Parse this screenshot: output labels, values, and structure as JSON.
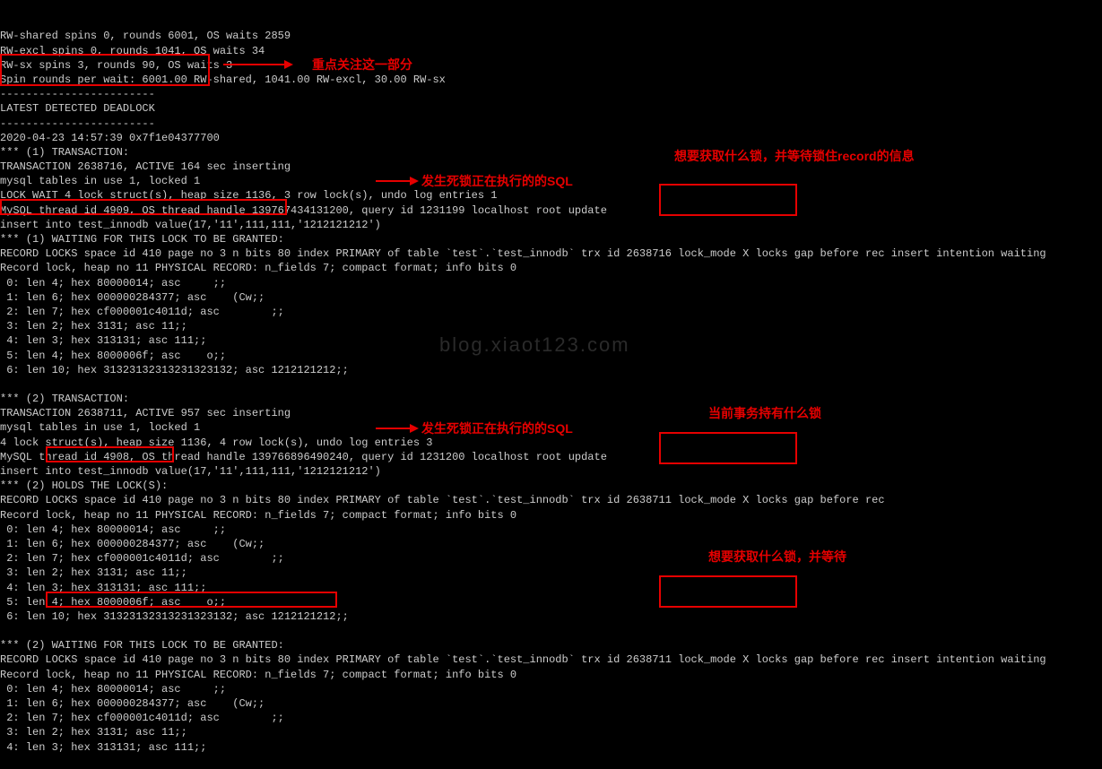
{
  "terminal": {
    "lines": [
      "RW-shared spins 0, rounds 6001, OS waits 2859",
      "RW-excl spins 0, rounds 1041, OS waits 34",
      "RW-sx spins 3, rounds 90, OS waits 3",
      "Spin rounds per wait: 6001.00 RW-shared, 1041.00 RW-excl, 30.00 RW-sx",
      "------------------------",
      "LATEST DETECTED DEADLOCK",
      "------------------------",
      "2020-04-23 14:57:39 0x7f1e04377700",
      "*** (1) TRANSACTION:",
      "TRANSACTION 2638716, ACTIVE 164 sec inserting",
      "mysql tables in use 1, locked 1",
      "LOCK WAIT 4 lock struct(s), heap size 1136, 3 row lock(s), undo log entries 1",
      "MySQL thread id 4909, OS thread handle 139767434131200, query id 1231199 localhost root update",
      "insert into test_innodb value(17,'11',111,111,'1212121212')",
      "*** (1) WAITING FOR THIS LOCK TO BE GRANTED:",
      "RECORD LOCKS space id 410 page no 3 n bits 80 index PRIMARY of table `test`.`test_innodb` trx id 2638716 lock_mode X locks gap before rec insert intention waiting",
      "Record lock, heap no 11 PHYSICAL RECORD: n_fields 7; compact format; info bits 0",
      " 0: len 4; hex 80000014; asc     ;;",
      " 1: len 6; hex 000000284377; asc    (Cw;;",
      " 2: len 7; hex cf000001c4011d; asc        ;;",
      " 3: len 2; hex 3131; asc 11;;",
      " 4: len 3; hex 313131; asc 111;;",
      " 5: len 4; hex 8000006f; asc    o;;",
      " 6: len 10; hex 31323132313231323132; asc 1212121212;;",
      " ",
      "*** (2) TRANSACTION:",
      "TRANSACTION 2638711, ACTIVE 957 sec inserting",
      "mysql tables in use 1, locked 1",
      "4 lock struct(s), heap size 1136, 4 row lock(s), undo log entries 3",
      "MySQL thread id 4908, OS thread handle 139766896490240, query id 1231200 localhost root update",
      "insert into test_innodb value(17,'11',111,111,'1212121212')",
      "*** (2) HOLDS THE LOCK(S):",
      "RECORD LOCKS space id 410 page no 3 n bits 80 index PRIMARY of table `test`.`test_innodb` trx id 2638711 lock_mode X locks gap before rec",
      "Record lock, heap no 11 PHYSICAL RECORD: n_fields 7; compact format; info bits 0",
      " 0: len 4; hex 80000014; asc     ;;",
      " 1: len 6; hex 000000284377; asc    (Cw;;",
      " 2: len 7; hex cf000001c4011d; asc        ;;",
      " 3: len 2; hex 3131; asc 11;;",
      " 4: len 3; hex 313131; asc 111;;",
      " 5: len 4; hex 8000006f; asc    o;;",
      " 6: len 10; hex 31323132313231323132; asc 1212121212;;",
      " ",
      "*** (2) WAITING FOR THIS LOCK TO BE GRANTED:",
      "RECORD LOCKS space id 410 page no 3 n bits 80 index PRIMARY of table `test`.`test_innodb` trx id 2638711 lock_mode X locks gap before rec insert intention waiting",
      "Record lock, heap no 11 PHYSICAL RECORD: n_fields 7; compact format; info bits 0",
      " 0: len 4; hex 80000014; asc     ;;",
      " 1: len 6; hex 000000284377; asc    (Cw;;",
      " 2: len 7; hex cf000001c4011d; asc        ;;",
      " 3: len 2; hex 3131; asc 11;;",
      " 4: len 3; hex 313131; asc 111;;"
    ]
  },
  "annotations": {
    "label1": "重点关注这一部分",
    "label2": "想要获取什么锁，并等待锁住record的信息",
    "label3": "发生死锁正在执行的的SQL",
    "label4": "当前事务持有什么锁",
    "label5": "发生死锁正在执行的的SQL",
    "label6": "想要获取什么锁，并等待"
  },
  "watermark": "blog.xiaot123.com"
}
